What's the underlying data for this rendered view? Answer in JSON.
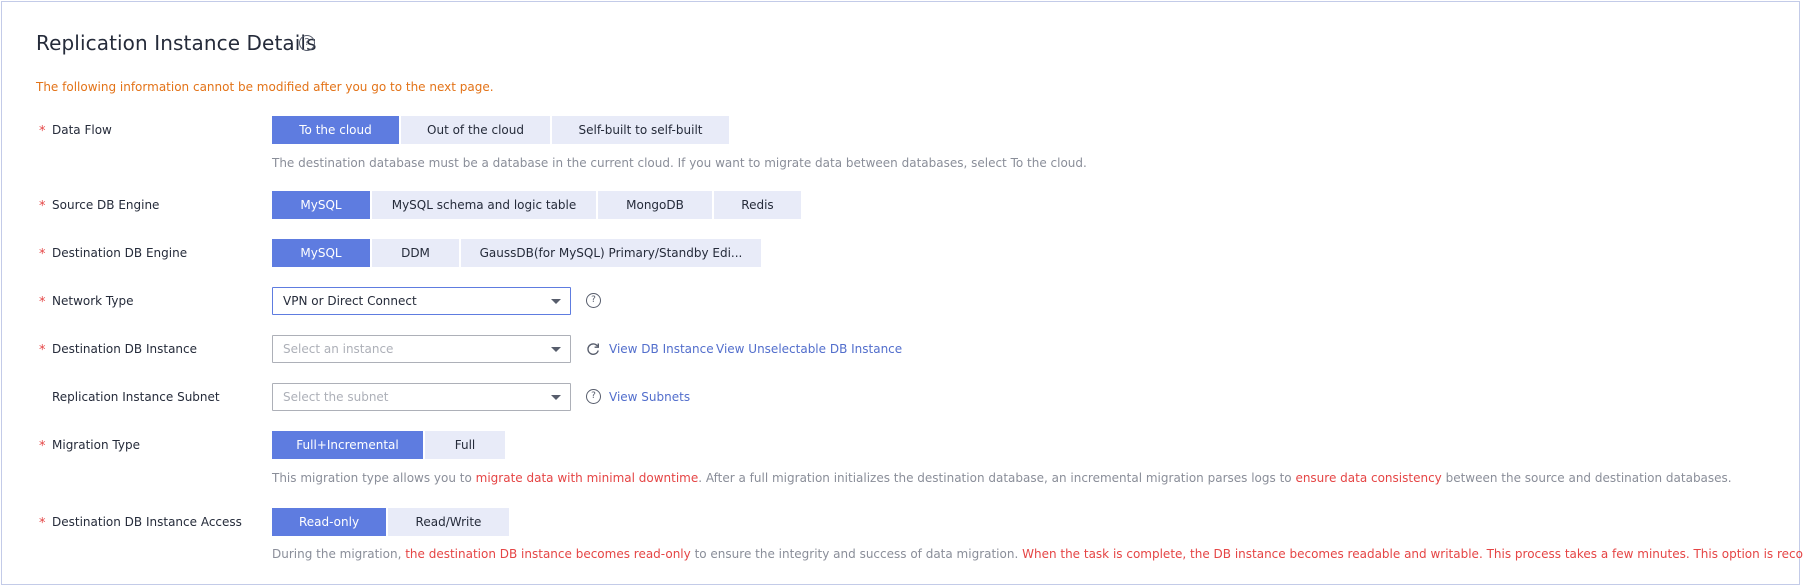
{
  "header": {
    "title": "Replication Instance Details",
    "help_icon": "question-circle-icon",
    "warning": "The following information cannot be modified after you go to the next page."
  },
  "data_flow": {
    "label": "Data Flow",
    "options": [
      "To the cloud",
      "Out of the cloud",
      "Self-built to self-built"
    ],
    "selected": "To the cloud",
    "hint": "The destination database must be a database in the current cloud. If you want to migrate data between databases, select To the cloud."
  },
  "source_engine": {
    "label": "Source DB Engine",
    "options": [
      "MySQL",
      "MySQL schema and logic table",
      "MongoDB",
      "Redis"
    ],
    "selected": "MySQL"
  },
  "dest_engine": {
    "label": "Destination DB Engine",
    "options": [
      "MySQL",
      "DDM",
      "GaussDB(for MySQL) Primary/Standby Edi..."
    ],
    "selected": "MySQL"
  },
  "network_type": {
    "label": "Network Type",
    "value": "VPN or Direct Connect"
  },
  "dest_instance": {
    "label": "Destination DB Instance",
    "placeholder": "Select an instance",
    "view_link": "View DB Instance",
    "unselectable_link": "View Unselectable DB Instance"
  },
  "subnet": {
    "label": "Replication Instance Subnet",
    "placeholder": "Select the subnet",
    "link": "View Subnets"
  },
  "migration_type": {
    "label": "Migration Type",
    "options": [
      "Full+Incremental",
      "Full"
    ],
    "selected": "Full+Incremental",
    "hint": {
      "p1": "This migration type allows you to ",
      "r1": "migrate data with minimal downtime",
      "p2": ". After a full migration initializes the destination database, an incremental migration parses logs to ",
      "r2": "ensure data consistency",
      "p3": " between the source and destination databases."
    }
  },
  "access": {
    "label": "Destination DB Instance Access",
    "options": [
      "Read-only",
      "Read/Write"
    ],
    "selected": "Read-only",
    "hint": {
      "p1": "During the migration, ",
      "r1": "the destination DB instance becomes read-only",
      "p2": " to ensure the integrity and success of data migration. ",
      "r2": "When the task is complete, the DB instance becomes readable and writable. This process takes a few minutes. This option is recommended."
    }
  },
  "colors": {
    "accent": "#5e7ce0",
    "segment_bg": "#e8ebf8",
    "warning": "#e37318",
    "required": "#e54545",
    "link": "#526ecc"
  }
}
